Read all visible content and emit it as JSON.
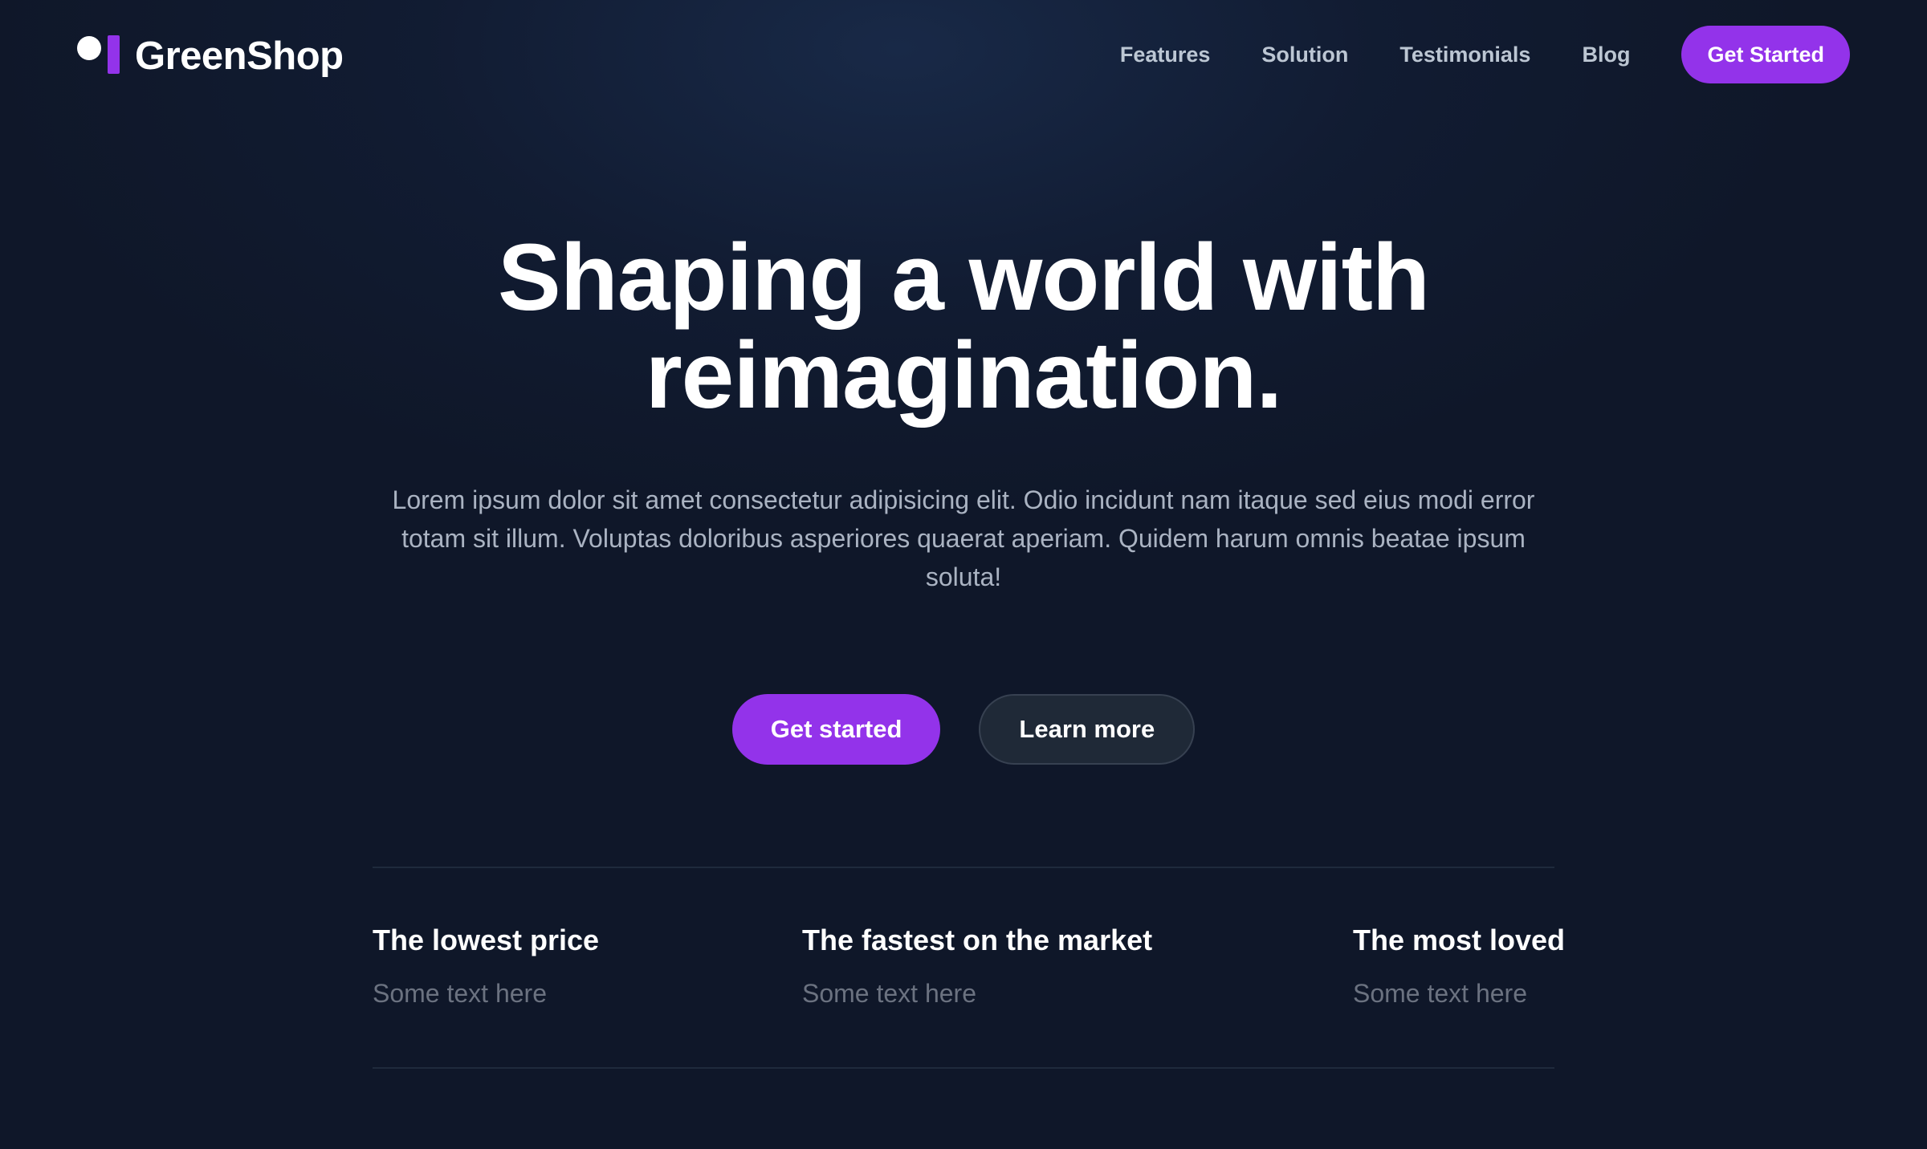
{
  "brand": {
    "name": "GreenShop",
    "accent_color": "#9333ea",
    "logo_icon": "dot-and-bar-logo-icon"
  },
  "nav": {
    "links": [
      "Features",
      "Solution",
      "Testimonials",
      "Blog"
    ],
    "cta_label": "Get Started"
  },
  "hero": {
    "title_line1": "Shaping a world with",
    "title_line2": "reimagination.",
    "description": "Lorem ipsum dolor sit amet consectetur adipisicing elit. Odio incidunt nam itaque sed eius modi error totam sit illum. Voluptas doloribus asperiores quaerat aperiam. Quidem harum omnis beatae ipsum soluta!",
    "primary_button": "Get started",
    "secondary_button": "Learn more"
  },
  "features": [
    {
      "title": "The lowest price",
      "text": "Some text here"
    },
    {
      "title": "The fastest on the market",
      "text": "Some text here"
    },
    {
      "title": "The most loved",
      "text": "Some text here"
    }
  ],
  "colors": {
    "background": "#0f1729",
    "text_primary": "#ffffff",
    "text_muted": "#6b7280",
    "secondary_button_bg": "#1f2937"
  }
}
